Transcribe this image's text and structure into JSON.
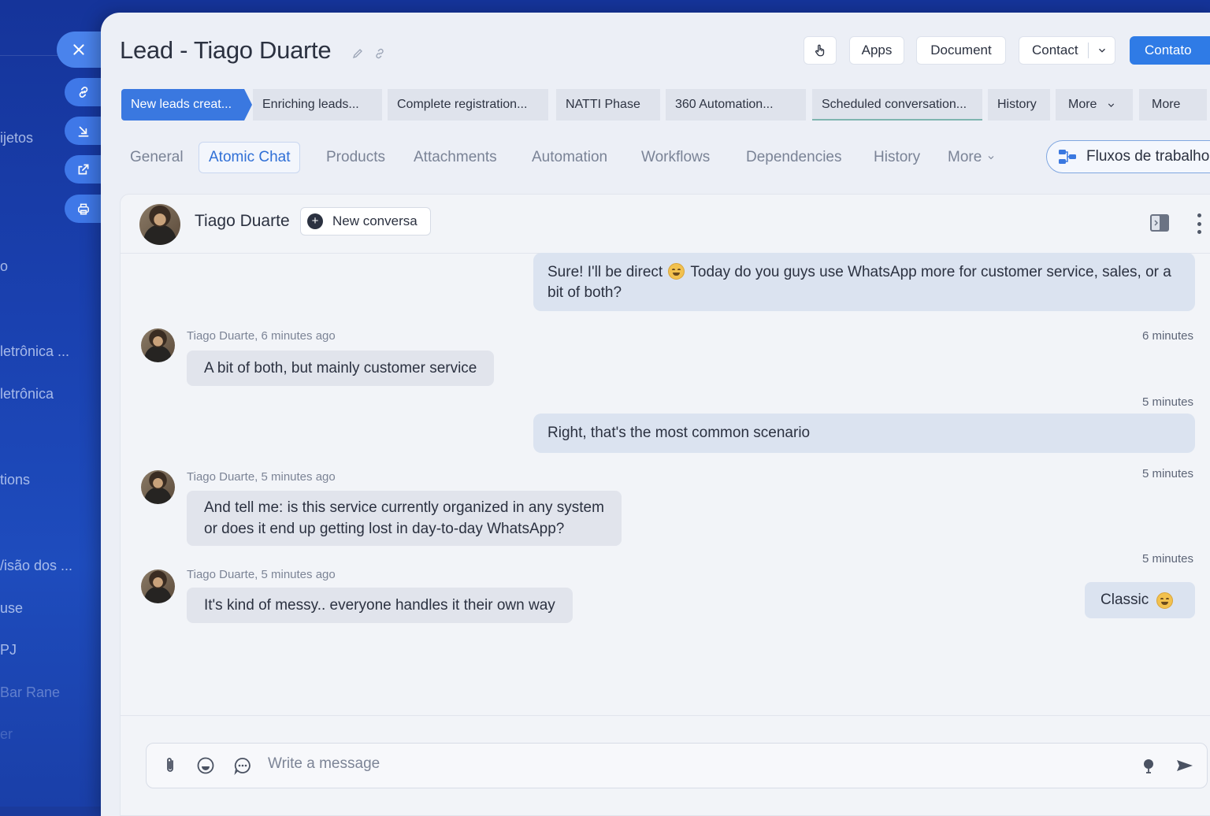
{
  "background_app": {
    "sidebar_items": [
      "ijetos",
      "o",
      "letrônica ...",
      "letrônica",
      "tions",
      "/isão dos ...",
      "use",
      "PJ",
      "Bar Rane",
      "er"
    ]
  },
  "lead": {
    "title": "Lead - Tiago Duarte"
  },
  "toolbar": {
    "apps": "Apps",
    "document": "Document",
    "contact": "Contact",
    "primary": "Contato"
  },
  "stages": [
    "New leads creat...",
    "Enriching leads...",
    "Complete registration...",
    "NATTI Phase",
    "360 Automation...",
    "Scheduled conversation...",
    "History",
    "More",
    "More"
  ],
  "tabs": [
    "General",
    "Atomic Chat",
    "Products",
    "Attachments",
    "Automation",
    "Workflows",
    "Dependencies",
    "History",
    "More"
  ],
  "workflows_button": "Fluxos de trabalho",
  "chat": {
    "contact_name": "Tiago Duarte",
    "new_conversation": "New conversa",
    "messages": [
      {
        "direction": "out",
        "text_a": "Sure! I'll be direct",
        "text_b": "Today do you guys use WhatsApp more for customer service, sales, or a bit of both?"
      },
      {
        "direction": "in",
        "meta": "Tiago Duarte, 6 minutes ago",
        "time": "6 minutes",
        "text": "A bit of both, but mainly customer service"
      },
      {
        "direction": "out",
        "time": "5 minutes",
        "text": "Right, that's the most common scenario"
      },
      {
        "direction": "in",
        "meta": "Tiago Duarte, 5 minutes ago",
        "time": "5 minutes",
        "line1": "And tell me: is this service currently organized in any system",
        "line2": "or does it end up getting lost in day-to-day WhatsApp?"
      },
      {
        "direction": "in",
        "meta": "Tiago Duarte, 5 minutes ago",
        "time": "5 minutes",
        "text": "It's kind of messy.. everyone handles it their own way"
      },
      {
        "direction": "out",
        "text": "Classic"
      }
    ],
    "composer_placeholder": "Write a message"
  },
  "colors": {
    "accent": "#2f7be6",
    "active_stage": "#3a78e0",
    "background_app": "#1a41b0"
  }
}
